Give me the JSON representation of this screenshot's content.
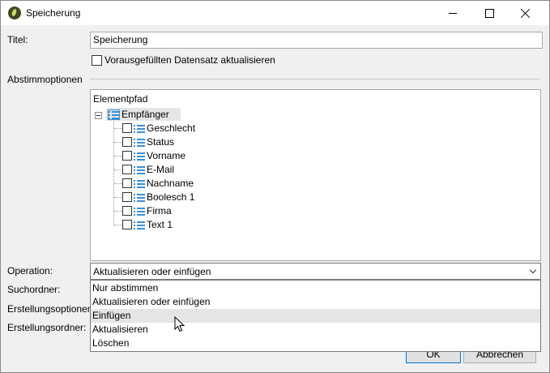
{
  "window": {
    "title": "Speicherung",
    "minimize_icon": "minimize-icon",
    "maximize_icon": "maximize-icon",
    "close_icon": "close-icon"
  },
  "form": {
    "title_label": "Titel:",
    "title_value": "Speicherung",
    "update_prefilled_label": "Vorausgefüllten Datensatz aktualisieren",
    "update_prefilled_checked": false,
    "reconciliation_label": "Abstimmoptionen"
  },
  "tree": {
    "header": "Elementpfad",
    "root": "Empfänger",
    "children": [
      {
        "label": "Geschlecht",
        "checked": false
      },
      {
        "label": "Status",
        "checked": false
      },
      {
        "label": "Vorname",
        "checked": false
      },
      {
        "label": "E-Mail",
        "checked": false
      },
      {
        "label": "Nachname",
        "checked": false
      },
      {
        "label": "Boolesch 1",
        "checked": false
      },
      {
        "label": "Firma",
        "checked": false
      },
      {
        "label": "Text 1",
        "checked": false
      }
    ]
  },
  "operation": {
    "label": "Operation:",
    "selected": "Aktualisieren oder einfügen",
    "options": [
      "Nur abstimmen",
      "Aktualisieren oder einfügen",
      "Einfügen",
      "Aktualisieren",
      "Löschen"
    ],
    "hovered_option": "Einfügen"
  },
  "labels": {
    "search_folder": "Suchordner:",
    "creation_options": "Erstellungsoptionen",
    "creation_folder": "Erstellungsordner:"
  },
  "buttons": {
    "ok": "OK",
    "cancel": "Abbrechen"
  }
}
